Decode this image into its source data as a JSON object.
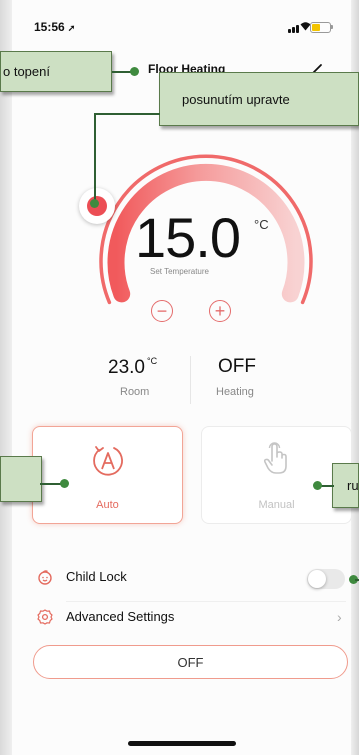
{
  "status_bar": {
    "time": "15:56",
    "location_glyph": "➚",
    "battery_color": "#f3c400"
  },
  "header": {
    "title": "Floor Heating",
    "edit_icon": "pencil-icon"
  },
  "callouts": {
    "left_top": "o topení",
    "top_right": "posunutím upravte",
    "left_mid": "",
    "right_mid": "ru"
  },
  "dial": {
    "value": "15.0",
    "unit": "°C",
    "caption": "Set Temperature",
    "minus_label": "−",
    "plus_label": "+",
    "accent_color": "#ec4e55"
  },
  "readouts": {
    "room": {
      "value": "23.0",
      "unit": "°C",
      "label": "Room"
    },
    "heating": {
      "value": "OFF",
      "label": "Heating"
    }
  },
  "modes": [
    {
      "label": "Auto",
      "icon": "auto-mode-icon",
      "selected": true
    },
    {
      "label": "Manual",
      "icon": "hand-pointer-icon",
      "selected": false
    }
  ],
  "settings": {
    "child_lock": {
      "label": "Child Lock",
      "icon": "child-face-icon",
      "enabled": false
    },
    "advanced": {
      "label": "Advanced Settings",
      "icon": "gear-icon",
      "chevron": "›"
    }
  },
  "power_button": {
    "label": "OFF"
  },
  "colors": {
    "accent": "#ec4e55",
    "callout_bg": "#cde0c3",
    "callout_dot": "#3f8a3f"
  }
}
